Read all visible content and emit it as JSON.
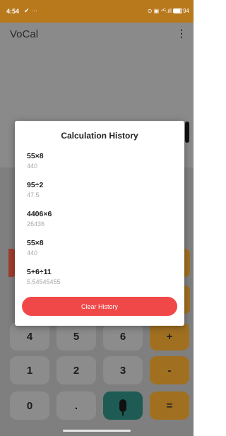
{
  "status_bar": {
    "time": "4:54",
    "extra": "✔ ···",
    "right_text": "⊙ ▣ ⁴ᴳ.ıll",
    "battery": "94"
  },
  "app": {
    "title": "VoCal",
    "menu_icon": "more-vertical-icon"
  },
  "keypad": {
    "row4": [
      "4",
      "5",
      "6",
      "+"
    ],
    "row5": [
      "1",
      "2",
      "3",
      "-"
    ],
    "row6": [
      "0",
      ".",
      "mic-icon",
      "="
    ]
  },
  "dialog": {
    "title": "Calculation History",
    "items": [
      {
        "expression": "55×8",
        "result": "440"
      },
      {
        "expression": "95÷2",
        "result": "47.5"
      },
      {
        "expression": "4406×6",
        "result": "26436"
      },
      {
        "expression": "55×8",
        "result": "440"
      },
      {
        "expression": "5+6÷11",
        "result": "5.54545455"
      }
    ],
    "clear_label": "Clear History",
    "clear_color": "#f04848"
  }
}
